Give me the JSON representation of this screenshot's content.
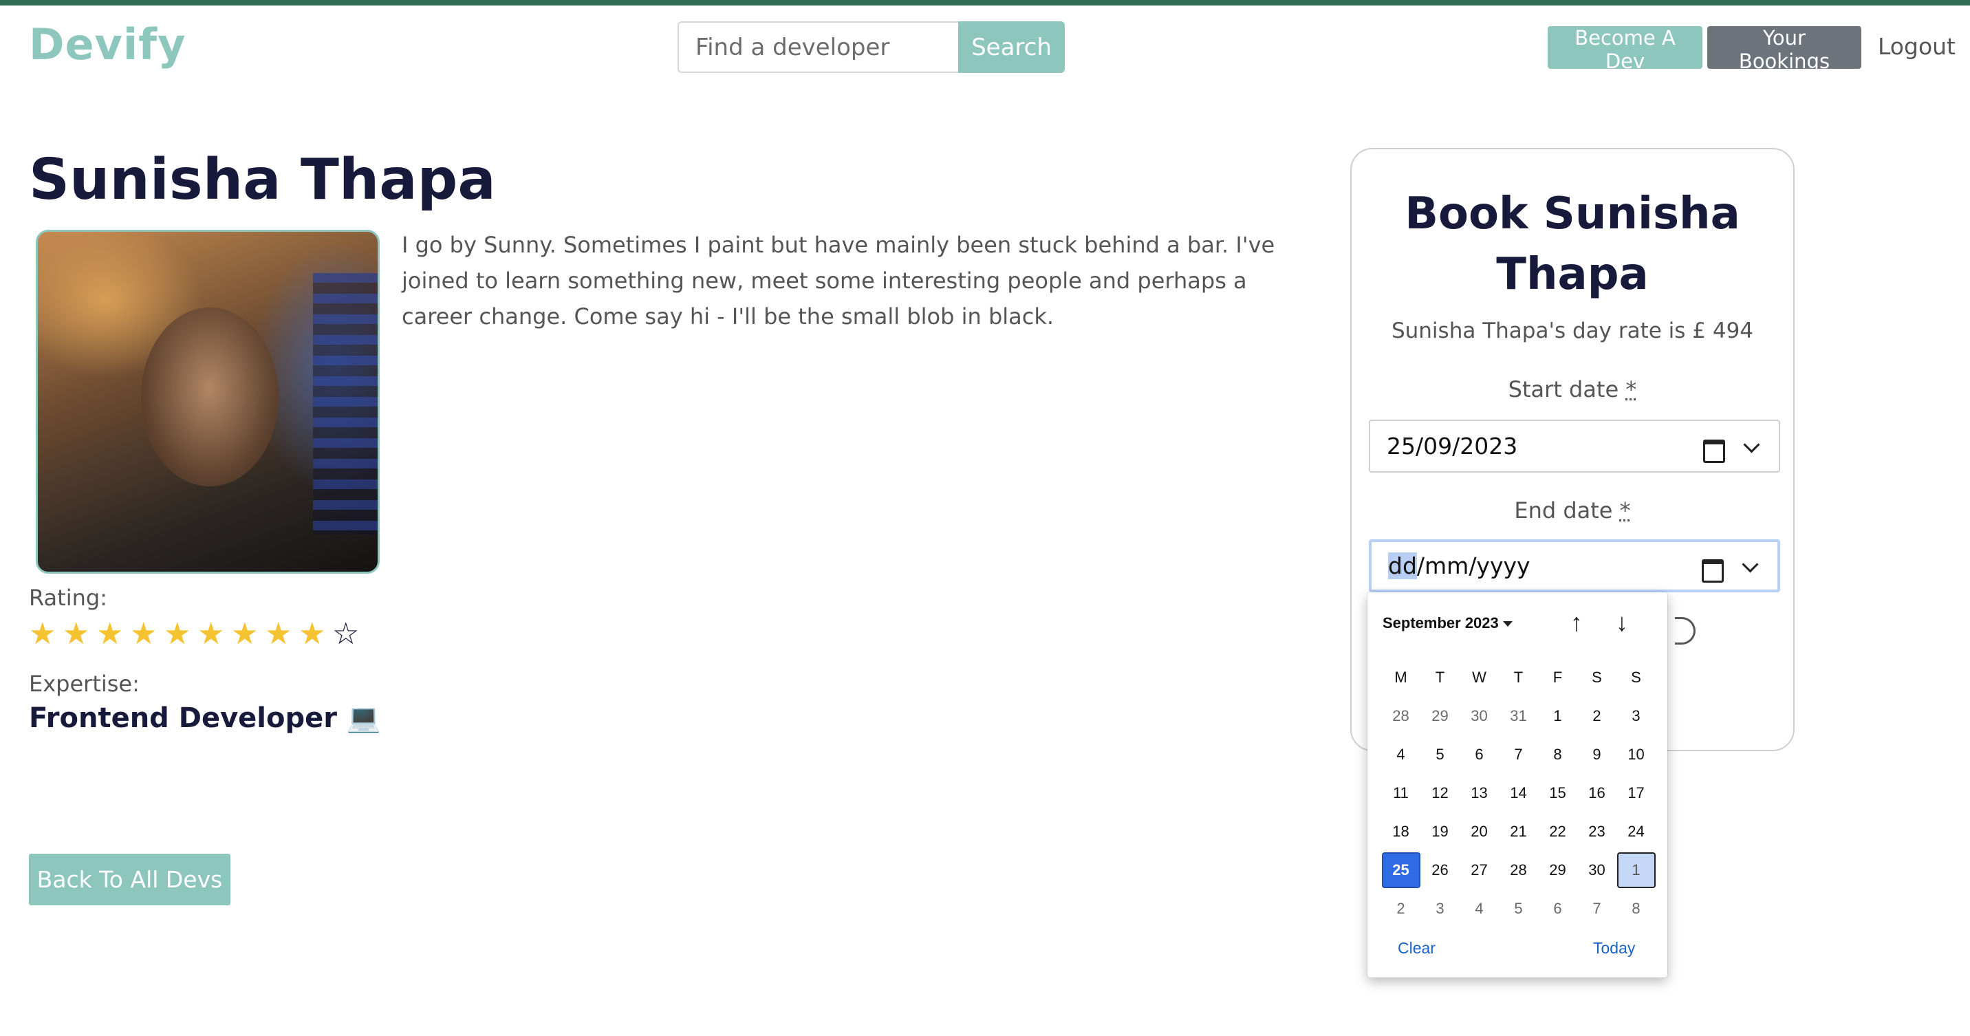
{
  "header": {
    "brand": "Devify",
    "search_placeholder": "Find a developer",
    "search_label": "Search",
    "become_dev_label": "Become A Dev",
    "bookings_label": "Your Bookings",
    "logout_label": "Logout"
  },
  "profile": {
    "name": "Sunisha Thapa",
    "bio": "I go by Sunny. Sometimes I paint but have mainly been stuck behind a bar. I've joined to learn something new, meet some interesting people and perhaps a career change. Come say hi - I'll be the small blob in black.",
    "rating_label": "Rating:",
    "rating_value": 9,
    "rating_max": 10,
    "expertise_label": "Expertise:",
    "expertise": "Frontend Developer 💻",
    "back_label": "Back To All Devs"
  },
  "booking": {
    "title": "Book Sunisha Thapa",
    "rate_text": "Sunisha Thapa's day rate is £ 494",
    "start_label": "Start date",
    "end_label": "End date",
    "required_mark": "*",
    "start_value": "25/09/2023",
    "end_placeholder_hl": "dd",
    "end_placeholder_rest": "/mm/yyyy"
  },
  "datepicker": {
    "month_label": "September 2023",
    "weekdays": [
      "M",
      "T",
      "W",
      "T",
      "F",
      "S",
      "S"
    ],
    "weeks": [
      [
        "28",
        "29",
        "30",
        "31",
        "1",
        "2",
        "3"
      ],
      [
        "4",
        "5",
        "6",
        "7",
        "8",
        "9",
        "10"
      ],
      [
        "11",
        "12",
        "13",
        "14",
        "15",
        "16",
        "17"
      ],
      [
        "18",
        "19",
        "20",
        "21",
        "22",
        "23",
        "24"
      ],
      [
        "25",
        "26",
        "27",
        "28",
        "29",
        "30",
        "1"
      ],
      [
        "2",
        "3",
        "4",
        "5",
        "6",
        "7",
        "8"
      ]
    ],
    "selected_day": "25",
    "clear_label": "Clear",
    "today_label": "Today",
    "up_icon": "↑",
    "down_icon": "↓"
  },
  "colors": {
    "accent": "#8cc6bd",
    "heading": "#171a3a",
    "top_bar": "#2f6b55",
    "selected_day": "#2e6be5"
  }
}
